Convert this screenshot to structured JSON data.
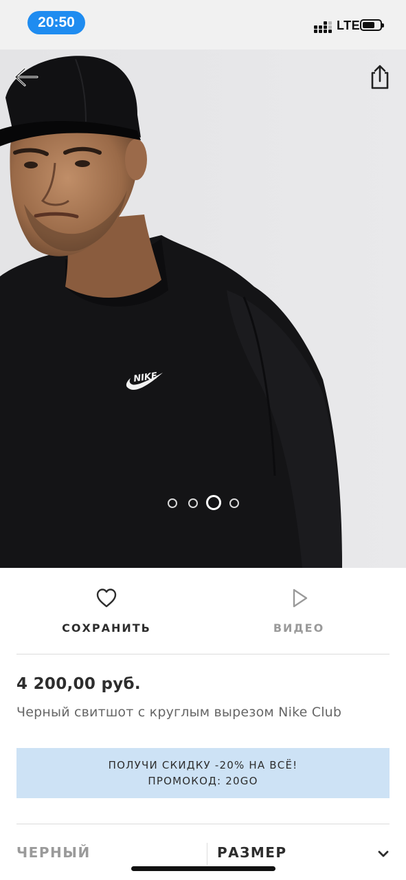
{
  "status_bar": {
    "time": "20:50",
    "network": "LTE",
    "battery_level": 0.7
  },
  "product_image": {
    "logo_text": "NIKE",
    "carousel": {
      "count": 4,
      "active_index": 2
    },
    "background_color": "#e6e6e8"
  },
  "actions": {
    "save_label": "СОХРАНИТЬ",
    "video_label": "ВИДЕО"
  },
  "product": {
    "price": "4 200,00 руб.",
    "name": "Черный свитшот с круглым вырезом Nike Club"
  },
  "promo": {
    "line1": "ПОЛУЧИ СКИДКУ -20% НА ВСЁ!",
    "line2": "ПРОМОКОД: 20GO",
    "background_color": "#cde2f5"
  },
  "selectors": {
    "color": "ЧЕРНЫЙ",
    "size": "РАЗМЕР"
  },
  "colors": {
    "status_pill": "#1f8cf0",
    "text_primary": "#2d2d2d",
    "text_secondary": "#666666",
    "text_muted": "#9a9a9a"
  },
  "icons": {
    "back": "arrow-left-icon",
    "share": "share-icon",
    "save": "heart-icon",
    "video": "play-icon",
    "size_dropdown": "chevron-down-icon"
  }
}
